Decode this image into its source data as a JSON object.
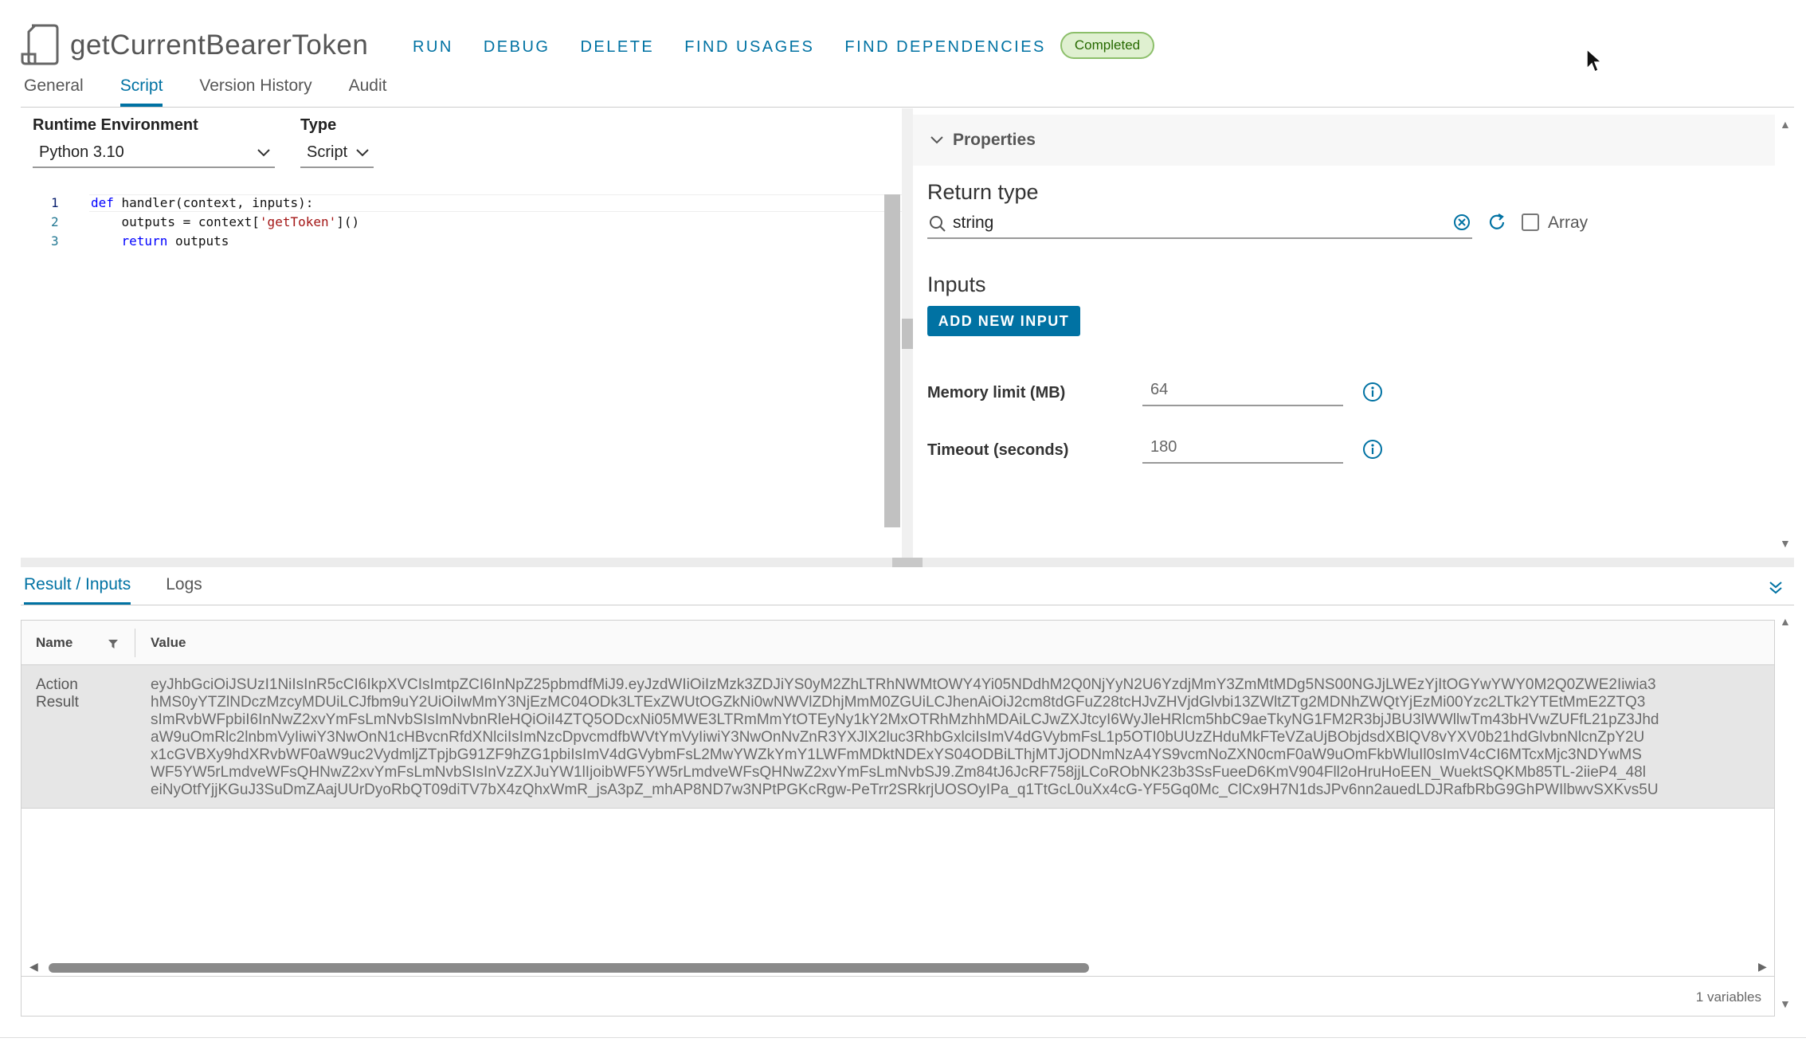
{
  "header": {
    "title": "getCurrentBearerToken",
    "actions": [
      "RUN",
      "DEBUG",
      "DELETE",
      "FIND USAGES",
      "FIND DEPENDENCIES"
    ],
    "status": "Completed",
    "tabs": [
      "General",
      "Script",
      "Version History",
      "Audit"
    ],
    "active_tab": "Script"
  },
  "script": {
    "runtime_label": "Runtime Environment",
    "runtime_value": "Python 3.10",
    "type_label": "Type",
    "type_value": "Script",
    "line_numbers": [
      "1",
      "2",
      "3"
    ]
  },
  "properties": {
    "section_label": "Properties",
    "return_type_title": "Return type",
    "return_type_value": "string",
    "array_label": "Array",
    "inputs_title": "Inputs",
    "add_input_label": "ADD NEW INPUT",
    "memory_label": "Memory limit (MB)",
    "memory_value": "64",
    "timeout_label": "Timeout (seconds)",
    "timeout_value": "180"
  },
  "results": {
    "tabs": [
      "Result / Inputs",
      "Logs"
    ],
    "active_tab": "Result / Inputs",
    "columns": [
      "Name",
      "Value"
    ],
    "rows": [
      {
        "name": "Action Result",
        "value_lines": [
          "eyJhbGciOiJSUzI1NiIsInR5cCI6IkpXVCIsImtpZCI6InNpZ25pbmdfMiJ9.eyJzdWIiOiIzMzk3ZDJiYS0yM2ZhLTRhNWMtOWY4Yi05NDdhM2Q0NjYyN2U6YzdjMmY3ZmMtMDg5NS00NGJjLWEzYjItOGYwYWY0M2Q0ZWE2Iiwia3",
          "hMS0yYTZlNDczMzcyMDUiLCJfbm9uY2UiOiIwMmY3NjEzMC04ODk3LTExZWUtOGZkNi0wNWVlZDhjMmM0ZGUiLCJhenAiOiJ2cm8tdGFuZ28tcHJvZHVjdGlvbi13ZWltZTg2MDNhZWQtYjEzMi00Yzc2LTk2YTEtMmE2ZTQ3",
          "sImRvbWFpbiI6InNwZ2xvYmFsLmNvbSIsImNvbnRleHQiOiI4ZTQ5ODcxNi05MWE3LTRmMmYtOTEyNy1kY2MxOTRhMzhhMDAiLCJwZXJtcyI6WyJleHRlcm5hbC9aeTkyNG1FM2R3bjJBU3lWWllwTm43bHVwZUFfL21pZ3Jhd",
          "aW9uOmRlc2lnbmVyIiwiY3NwOnN1cHBvcnRfdXNlciIsImNzcDpvcmdfbWVtYmVyIiwiY3NwOnNvZnR3YXJlX2luc3RhbGxlciIsImV4dGVybmFsL1p5OTI0bUUzZHduMkFTeVZaUjBObjdsdXBlQV8vYXV0b21hdGlvbnNlcnZpY2U",
          "x1cGVBXy9hdXRvbWF0aW9uc2VydmljZTpjbG91ZF9hZG1pbiIsImV4dGVybmFsL2MwYWZkYmY1LWFmMDktNDExYS04ODBiLThjMTJjODNmNzA4YS9vcmNoZXN0cmF0aW9uOmFkbWluIl0sImV4cCI6MTcxMjc3NDYwMS",
          "WF5YW5rLmdveWFsQHNwZ2xvYmFsLmNvbSIsInVzZXJuYW1lIjoibWF5YW5rLmdveWFsQHNwZ2xvYmFsLmNvbSJ9.Zm84tJ6JcRF758jjLCoRObNK23b3SsFueeD6KmV904Fll2oHruHoEEN_WuektSQKMb85TL-2iieP4_48l",
          "eiNyOtfYjjKGuJ3SuDmZAajUUrDyoRbQT09diTV7bX4zQhxWmR_jsA3pZ_mhAP8ND7w3NPtPGKcRgw-PeTrr2SRkrjUOSOyIPa_q1TtGcL0uXx4cG-YF5Gq0Mc_ClCx9H7N1dsJPv6nn2auedLDJRafbRbG9GhPWIlbwvSXKvs5U"
        ]
      }
    ],
    "footer_count": "1 variables"
  },
  "colors": {
    "accent": "#0072a3",
    "badge_bg": "#dff0d0",
    "badge_border": "#8cbf6a",
    "badge_text": "#266900"
  }
}
